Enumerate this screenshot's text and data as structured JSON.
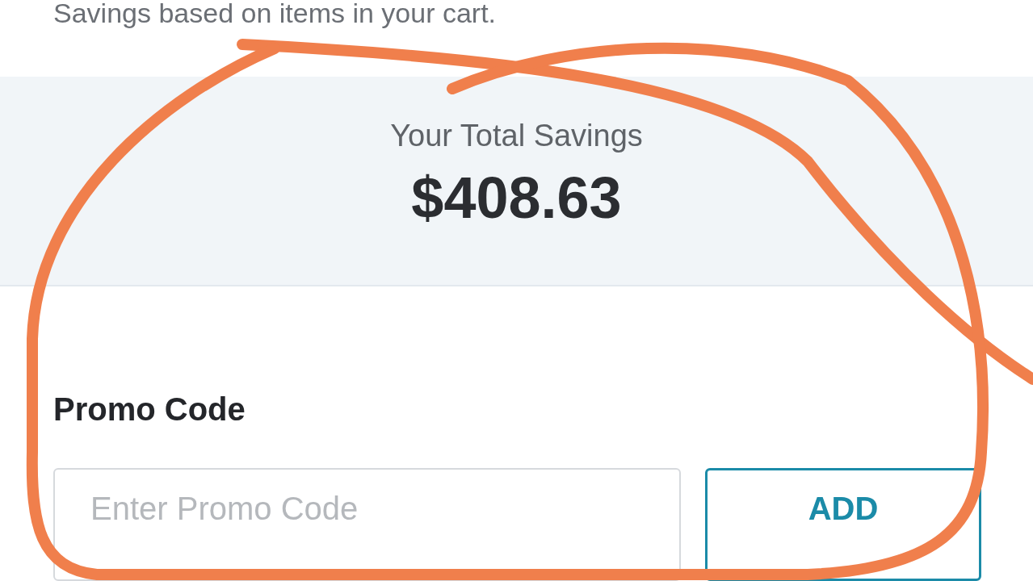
{
  "subtitle": "Savings based on items in your cart.",
  "savings": {
    "label": "Your Total Savings",
    "amount": "$408.63"
  },
  "promo": {
    "heading": "Promo Code",
    "placeholder": "Enter Promo Code",
    "button": "ADD"
  },
  "annotation": {
    "kind": "scribble"
  }
}
